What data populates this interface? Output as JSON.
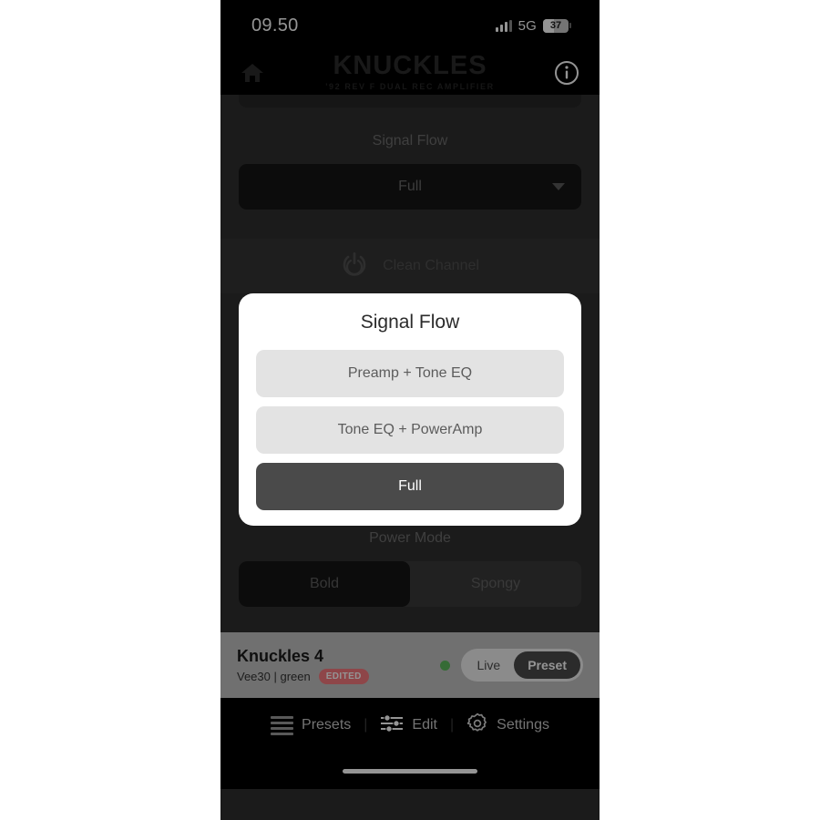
{
  "status_bar": {
    "time": "09.50",
    "network": "5G",
    "battery_percent": "37",
    "signal_icon": "cellular-signal-icon",
    "battery_icon": "battery-icon"
  },
  "header": {
    "home_icon": "home-icon",
    "brand_name": "KNUCKLES",
    "brand_subtitle": "'92 REV F DUAL REC AMPLIFIER",
    "info_icon": "info-circle-icon"
  },
  "content": {
    "signal_flow_label": "Signal Flow",
    "signal_flow_value": "Full",
    "dropdown_icon": "chevron-down-icon",
    "channel_icon": "power-button-icon",
    "channel_label": "Clean Channel",
    "power_mode_label": "Power Mode",
    "power_mode_options": [
      {
        "label": "Bold",
        "selected": true
      },
      {
        "label": "Spongy",
        "selected": false
      }
    ]
  },
  "dialog": {
    "title": "Signal Flow",
    "options": [
      {
        "label": "Preamp + Tone EQ",
        "selected": false
      },
      {
        "label": "Tone EQ + PowerAmp",
        "selected": false
      },
      {
        "label": "Full",
        "selected": true
      }
    ]
  },
  "preset_bar": {
    "name": "Knuckles 4",
    "subtitle": "Vee30 | green",
    "edited_badge": "EDITED",
    "status_dot_color": "#5cb85c",
    "toggle": {
      "live_label": "Live",
      "preset_label": "Preset",
      "active": "Preset"
    }
  },
  "nav": {
    "items": [
      {
        "label": "Presets",
        "icon": "list-lines-icon"
      },
      {
        "label": "Edit",
        "icon": "sliders-icon"
      },
      {
        "label": "Settings",
        "icon": "gear-icon"
      }
    ],
    "separator": "|"
  }
}
